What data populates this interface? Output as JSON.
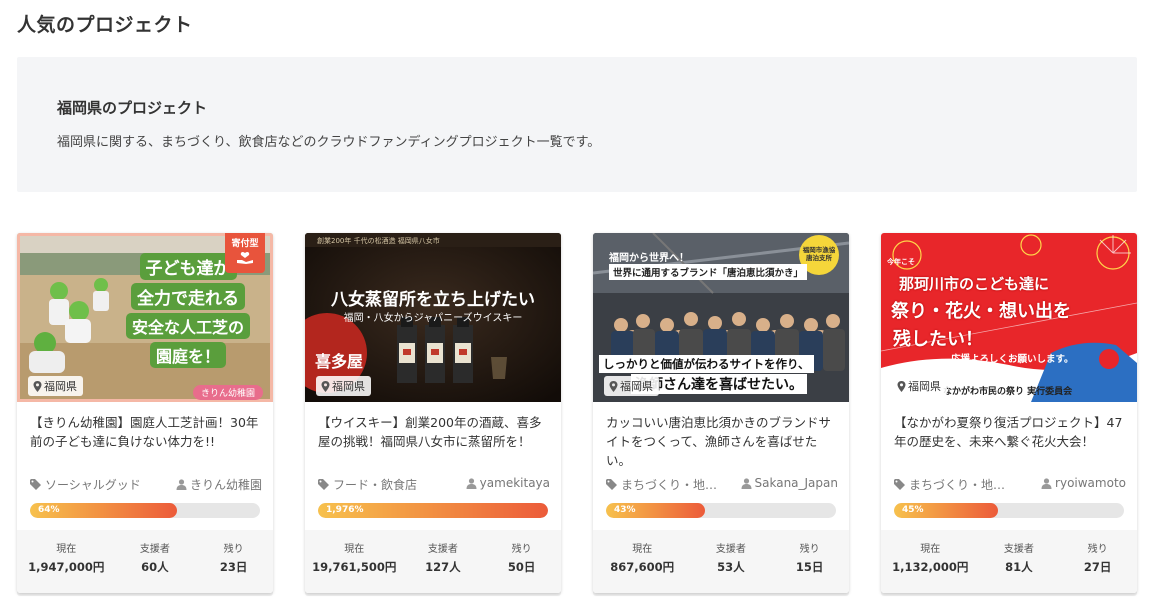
{
  "page": {
    "title": "人気のプロジェクト"
  },
  "prefecture": {
    "title": "福岡県のプロジェクト",
    "description": "福岡県に関する、まちづくり、飲食店などのクラウドファンディングプロジェクト一覧です。"
  },
  "labels": {
    "current": "現在",
    "supporters": "支援者",
    "remaining": "残り"
  },
  "cards": [
    {
      "location": "福岡県",
      "badge": "寄付型",
      "thumb_text": [
        "子ども達が",
        "全力で走れる",
        "安全な人工芝の",
        "園庭を！"
      ],
      "thumb_tag": "きりん幼稚園",
      "title": "【きりん幼稚園】園庭人工芝計画！30年前の子ども達に負けない体力を!!",
      "category": "ソーシャルグッド",
      "owner": "きりん幼稚園",
      "progress_label": "64%",
      "progress": 64,
      "current": "1,947,000円",
      "supporters": "60人",
      "remaining": "23日"
    },
    {
      "location": "福岡県",
      "thumb_header": "創業200年 千代の松酒造 福岡県八女市",
      "thumb_text": [
        "八女蒸留所を立ち上げたい",
        "福岡・八女からジャパニーズウイスキー"
      ],
      "thumb_tag": "喜多屋",
      "title": "【ウイスキー】創業200年の酒蔵、喜多屋の挑戦！福岡県八女市に蒸留所を！",
      "category": "フード・飲食店",
      "owner": "yamekitaya",
      "progress_label": "1,976%",
      "progress": 100,
      "current": "19,761,500円",
      "supporters": "127人",
      "remaining": "50日"
    },
    {
      "location": "福岡県",
      "thumb_text": [
        "福岡から世界へ！",
        "世界に通用するブランド「唐泊恵比須かき」",
        "しっかりと価値が伝わるサイトを作り、",
        "漁師さん達を喜ばせたい。"
      ],
      "thumb_tag": "福岡市漁協 唐泊支所",
      "title": "カッコいい唐泊恵比須かきのブランドサイトをつくって、漁師さんを喜ばせたい。",
      "category": "まちづくり・地…",
      "owner": "Sakana_Japan",
      "progress_label": "43%",
      "progress": 43,
      "current": "867,600円",
      "supporters": "53人",
      "remaining": "15日"
    },
    {
      "location": "福岡県",
      "thumb_text": [
        "那珂川市のこども達に",
        "祭り・花火・想い出を",
        "残したい！",
        "応援よろしくお願いします。"
      ],
      "thumb_tag": "なかがわ市民の祭り 実行委員会",
      "title": "【なかがわ夏祭り復活プロジェクト】47年の歴史を、未来へ繋ぐ花火大会！",
      "category": "まちづくり・地…",
      "owner": "ryoiwamoto",
      "progress_label": "45%",
      "progress": 45,
      "current": "1,132,000円",
      "supporters": "81人",
      "remaining": "27日"
    }
  ]
}
